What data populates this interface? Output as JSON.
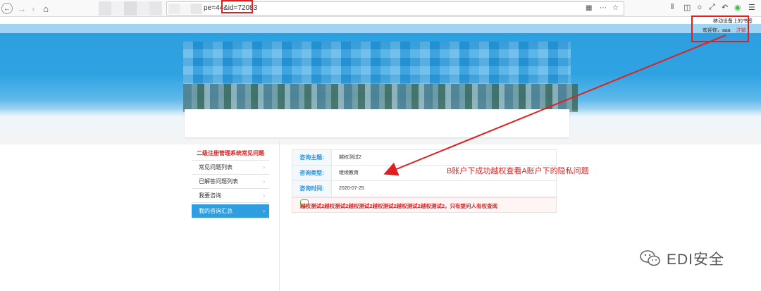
{
  "browser": {
    "url_visible": "pe=44&id=72083",
    "icons": [
      "back-icon",
      "forward-icon",
      "reload-icon",
      "home-icon",
      "qr-icon",
      "more-icon",
      "bookmark-star-icon",
      "library-icon",
      "sidebar-icon",
      "extension-icon",
      "screenshot-icon",
      "undo-icon",
      "extension-green-icon",
      "menu-icon"
    ]
  },
  "header": {
    "mobile_bookmarks": "移动设备上的书签",
    "welcome": "欢迎你，aaa",
    "logout": "注销"
  },
  "sidebar": {
    "title": "二级注册管理系统常见问题",
    "items": [
      {
        "label": "常见问题列表"
      },
      {
        "label": "已解答问题列表"
      },
      {
        "label": "我要咨询"
      },
      {
        "label": "我的咨询汇总"
      }
    ],
    "active_index": 3
  },
  "detail": {
    "rows": [
      {
        "label": "咨询主题:",
        "value": "越权测试2"
      },
      {
        "label": "咨询类型:",
        "value": "继续教育"
      },
      {
        "label": "咨询时间:",
        "value": "2020-07-25"
      }
    ],
    "content": "越权测试2越权测试2越权测试2越权测试2越权测试2越权测试2，只有提问人有权查阅"
  },
  "annotation": {
    "text": "B账户下成功越权查看A账户下的隐私问题",
    "color": "#e02020"
  },
  "watermark": {
    "text": "EDI安全"
  },
  "colors": {
    "accent": "#2f9ee0",
    "alert": "#e02020",
    "banner": "#2fa3e2"
  }
}
